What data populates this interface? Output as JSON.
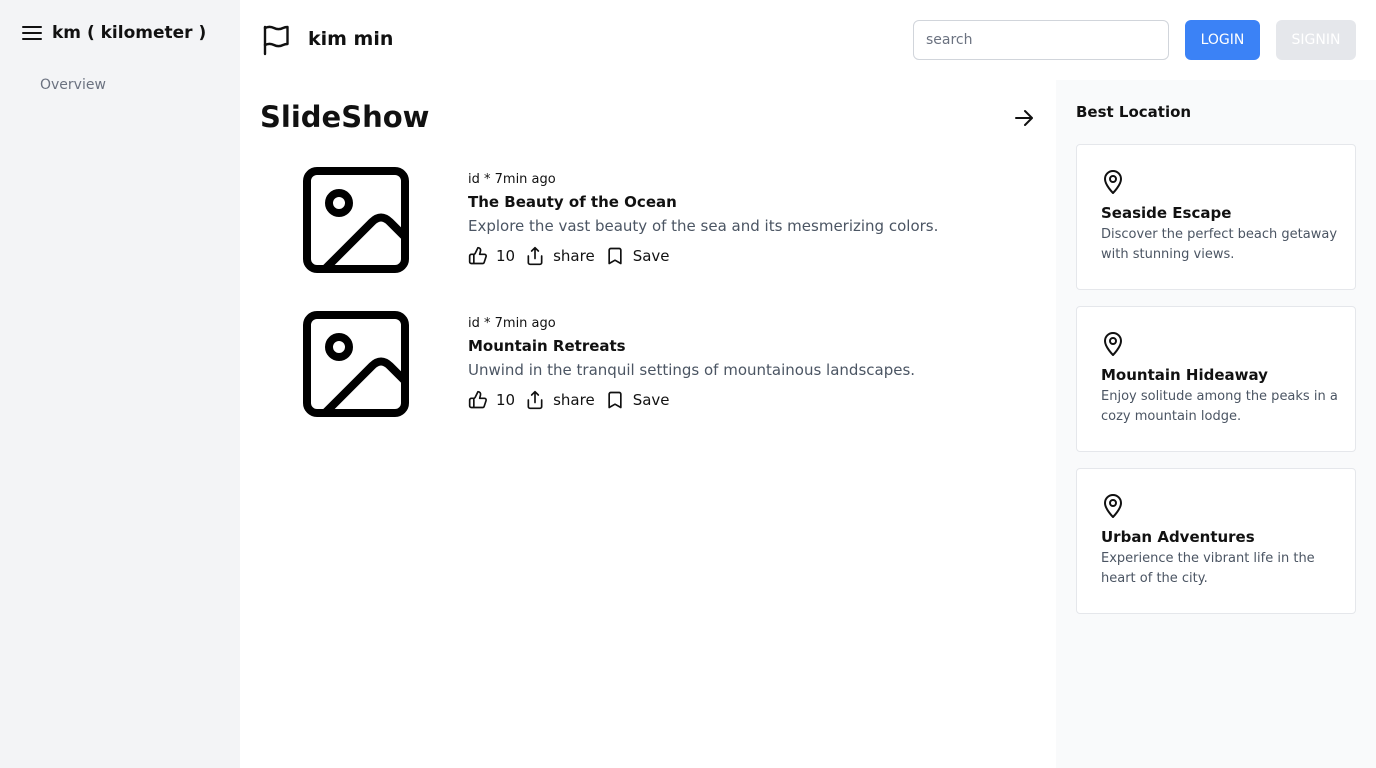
{
  "sidebar": {
    "icon": "menu-icon",
    "title": "km ( kilometer )",
    "items": [
      {
        "label": "Overview"
      }
    ]
  },
  "header": {
    "icon": "flag-icon",
    "brand": "kim min",
    "search_placeholder": "search",
    "login_label": "LOGIN",
    "signin_label": "SIGNIN",
    "accent_color": "#3b82f6"
  },
  "main": {
    "title": "SlideShow",
    "posts": [
      {
        "meta": "id * 7min ago",
        "title": "The Beauty of the Ocean",
        "description": "Explore the vast beauty of the sea and its mesmerizing colors.",
        "likes": "10",
        "share_label": "share",
        "save_label": "Save"
      },
      {
        "meta": "id * 7min ago",
        "title": "Mountain Retreats",
        "description": "Unwind in the tranquil settings of mountainous landscapes.",
        "likes": "10",
        "share_label": "share",
        "save_label": "Save"
      }
    ]
  },
  "right_panel": {
    "title": "Best Location",
    "cards": [
      {
        "icon": "map-pin-icon",
        "title": "Seaside Escape",
        "description": "Discover the perfect beach getaway with stunning views."
      },
      {
        "icon": "map-pin-icon",
        "title": "Mountain Hideaway",
        "description": "Enjoy solitude among the peaks in a cozy mountain lodge."
      },
      {
        "icon": "map-pin-icon",
        "title": "Urban Adventures",
        "description": "Experience the vibrant life in the heart of the city."
      }
    ]
  }
}
